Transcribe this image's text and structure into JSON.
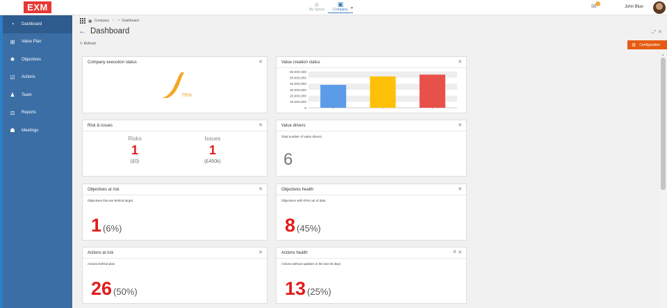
{
  "header": {
    "logo": "EXM",
    "spaces": [
      {
        "label": "My Space",
        "icon": "home-icon"
      },
      {
        "label": "Company",
        "icon": "company-icon"
      }
    ],
    "user_name": "John Blue"
  },
  "sidebar": {
    "items": [
      {
        "label": "Dashboard",
        "icon": "dashboard-icon"
      },
      {
        "label": "Value Plan",
        "icon": "value-plan-icon"
      },
      {
        "label": "Objectives",
        "icon": "objectives-icon"
      },
      {
        "label": "Actions",
        "icon": "actions-icon"
      },
      {
        "label": "Team",
        "icon": "team-icon"
      },
      {
        "label": "Reports",
        "icon": "reports-icon"
      },
      {
        "label": "Meetings",
        "icon": "meetings-icon"
      }
    ]
  },
  "breadcrumb": {
    "company": "Company",
    "dashboard": "Dashboard"
  },
  "page": {
    "title": "Dashboard",
    "refresh": "Refresh",
    "configuration": "Configuration"
  },
  "cards": {
    "execution": {
      "title": "Company execution status",
      "percent": "76%",
      "value": 0.76
    },
    "value_creation": {
      "title": "Value creation status"
    },
    "risks": {
      "title": "Risk & issues",
      "risks_label": "Risks",
      "issues_label": "Issues",
      "risks_count": "1",
      "issues_count": "1",
      "risks_value": "(£0)",
      "issues_value": "(£450k)"
    },
    "value_drivers": {
      "title": "Value drivers",
      "subtitle": "Total number of value drivers.",
      "count": "6"
    },
    "objectives_risk": {
      "title": "Objectives at risk",
      "subtitle": "Objectives that are behind target.",
      "count": "1",
      "percent": "(6%)"
    },
    "objectives_health": {
      "title": "Objectives health",
      "subtitle": "Objectives with KPIs out of date.",
      "count": "8",
      "percent": "(45%)"
    },
    "actions_risk": {
      "title": "Actions at risk",
      "subtitle": "Actions behind plan",
      "count": "26",
      "percent": "(50%)"
    },
    "actions_health": {
      "title": "Actions health",
      "subtitle": "Actions without updates in the last 30 days.",
      "count": "13",
      "percent": "(25%)"
    }
  },
  "chart_data": {
    "type": "bar",
    "categories": [
      "",
      "",
      ""
    ],
    "values": [
      38000000,
      52000000,
      55000000
    ],
    "colors": [
      "#5b9be8",
      "#ffc107",
      "#e8504a"
    ],
    "yticks": [
      "60,000,000",
      "50,000,000",
      "40,000,000",
      "30,000,000",
      "20,000,000",
      "10,000,000",
      "0"
    ],
    "ylim": [
      0,
      60000000
    ],
    "grid": true
  }
}
